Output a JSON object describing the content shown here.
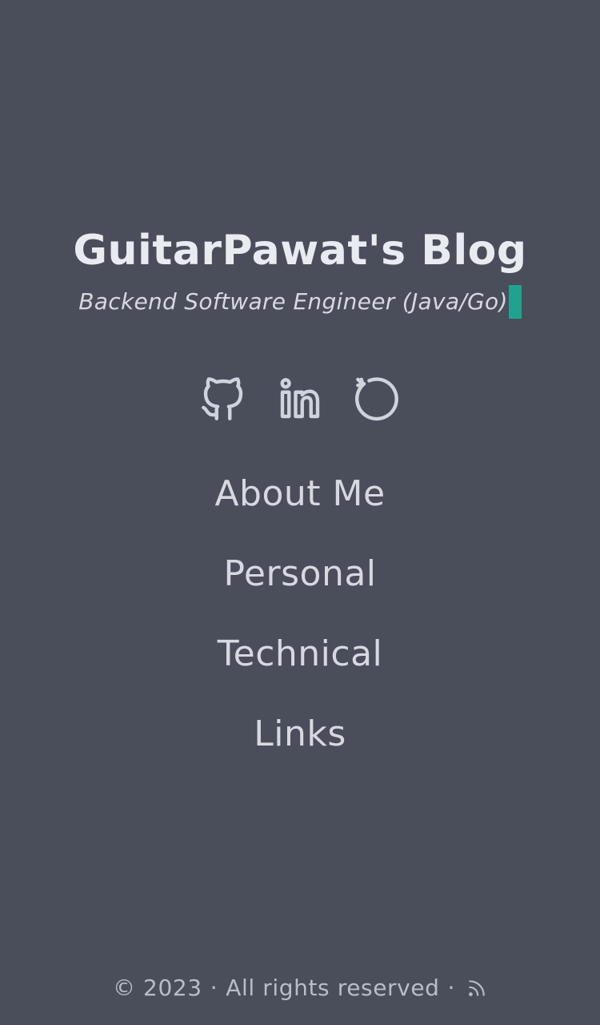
{
  "header": {
    "title": "GuitarPawat's Blog",
    "subtitle": "Backend Software Engineer (Java/Go)"
  },
  "socials": [
    {
      "icon": "github-icon"
    },
    {
      "icon": "linkedin-icon"
    },
    {
      "icon": "refresh-circle-icon"
    }
  ],
  "nav": {
    "items": [
      {
        "label": "About Me"
      },
      {
        "label": "Personal"
      },
      {
        "label": "Technical"
      },
      {
        "label": "Links"
      }
    ]
  },
  "footer": {
    "copyright": "© 2023",
    "separator": "·",
    "rights": "All rights reserved",
    "rss_icon": "rss-icon"
  },
  "colors": {
    "background": "#4a4e5a",
    "title": "#e8ebf0",
    "text": "#d6d9e0",
    "cursor": "#1fa38f",
    "footer": "#b9bdc6"
  }
}
